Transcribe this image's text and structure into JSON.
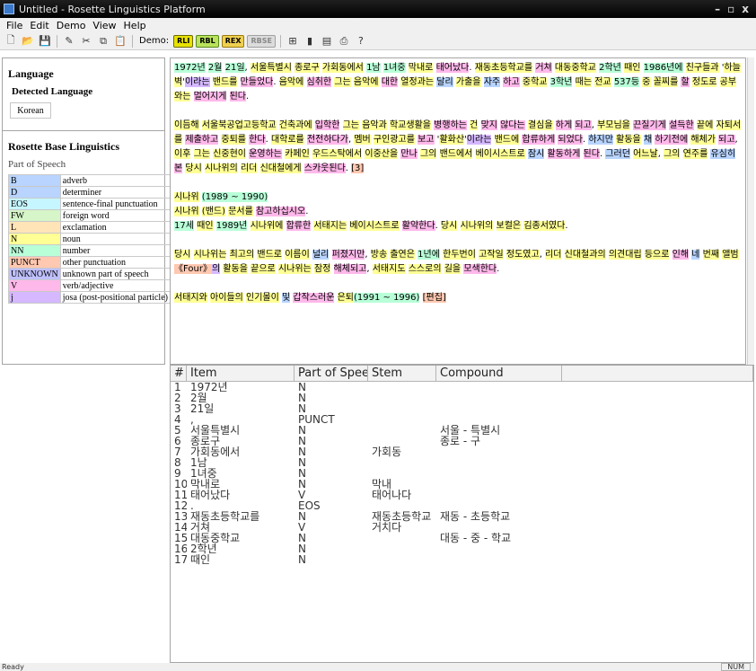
{
  "window": {
    "title": "Untitled - Rosette Linguistics Platform",
    "buttons": [
      "–",
      "▫",
      "x"
    ]
  },
  "menu": [
    "File",
    "Edit",
    "Demo",
    "View",
    "Help"
  ],
  "toolbar": {
    "demo_label": "Demo:",
    "demo_buttons": [
      "RLI",
      "RBL",
      "REX",
      "RBSE"
    ]
  },
  "language": {
    "title": "Language",
    "detected_label": "Detected Language",
    "value": "Korean"
  },
  "rbl": {
    "title": "Rosette Base Linguistics",
    "subtitle": "Part of Speech",
    "pos": [
      {
        "code": "B",
        "label": "adverb",
        "color": "#b8d4ff"
      },
      {
        "code": "D",
        "label": "determiner",
        "color": "#b8d4ff"
      },
      {
        "code": "EOS",
        "label": "sentence-final punctuation",
        "color": "#c6f6ff"
      },
      {
        "code": "FW",
        "label": "foreign word",
        "color": "#d6f5c8"
      },
      {
        "code": "L",
        "label": "exclamation",
        "color": "#ffe4b8"
      },
      {
        "code": "N",
        "label": "noun",
        "color": "#ffff96"
      },
      {
        "code": "NN",
        "label": "number",
        "color": "#b8ffd8"
      },
      {
        "code": "PUNCT",
        "label": "other punctuation",
        "color": "#ffc8b0"
      },
      {
        "code": "UNKNOWN",
        "label": "unknown part of speech",
        "color": "#c0c0ff"
      },
      {
        "code": "V",
        "label": "verb/adjective",
        "color": "#ffb8ea"
      },
      {
        "code": "j",
        "label": "josa (post-positional particle)",
        "color": "#d5b8ff"
      }
    ]
  },
  "text": {
    "paragraphs": [
      [
        [
          "1972년",
          "NN"
        ],
        " ",
        [
          "2월",
          "NN"
        ],
        " ",
        [
          "21일",
          "NN"
        ],
        ", ",
        [
          "서울특별시",
          "N"
        ],
        " ",
        [
          "종로구",
          "N"
        ],
        " ",
        [
          "가회동에서",
          "N"
        ],
        " ",
        [
          "1남",
          "NN"
        ],
        " ",
        [
          "1녀중",
          "NN"
        ],
        " ",
        [
          "막내로",
          "N"
        ],
        " ",
        [
          "태어났다",
          "V"
        ],
        ". ",
        [
          "재동초등학교를",
          "N"
        ],
        " ",
        [
          "거쳐",
          "V"
        ],
        " ",
        [
          "대동중학교",
          "N"
        ],
        " ",
        [
          "2학년",
          "NN"
        ],
        " ",
        [
          "때인",
          "N"
        ],
        " ",
        [
          "1986년에",
          "NN"
        ],
        " ",
        [
          "친구들과",
          "N"
        ],
        " '",
        [
          "하늘벽",
          "N"
        ],
        "'",
        [
          "이라는",
          "j"
        ],
        " ",
        [
          "밴드를",
          "N"
        ],
        " ",
        [
          "만들었다",
          "V"
        ],
        ". ",
        [
          "음악에",
          "N"
        ],
        " ",
        [
          "심취한",
          "V"
        ],
        " ",
        [
          "그는",
          "N"
        ],
        " ",
        [
          "음악에",
          "N"
        ],
        " ",
        [
          "대한",
          "V"
        ],
        " ",
        [
          "열정과는",
          "N"
        ],
        " ",
        [
          "달리",
          "B"
        ],
        " ",
        [
          "가출을",
          "N"
        ],
        " ",
        [
          "자주",
          "B"
        ],
        " ",
        [
          "하고",
          "V"
        ],
        " ",
        [
          "중학교",
          "N"
        ],
        " ",
        [
          "3학년",
          "NN"
        ],
        " ",
        [
          "때는",
          "N"
        ],
        " ",
        [
          "전교",
          "N"
        ],
        " ",
        [
          "537등",
          "NN"
        ],
        " ",
        [
          "중",
          "N"
        ],
        " ",
        [
          "꼴찌를",
          "N"
        ],
        " ",
        [
          "할",
          "V"
        ],
        " ",
        [
          "정도로",
          "N"
        ],
        " ",
        [
          "공부와는",
          "N"
        ],
        " ",
        [
          "멀어지게",
          "V"
        ],
        " ",
        [
          "된다",
          "V"
        ],
        "."
      ],
      [
        [
          "이듬해",
          "N"
        ],
        " ",
        [
          "서울북공업고등학교",
          "N"
        ],
        " ",
        [
          "건축과에",
          "N"
        ],
        " ",
        [
          "입학한",
          "V"
        ],
        " ",
        [
          "그는",
          "N"
        ],
        " ",
        [
          "음악과",
          "N"
        ],
        " ",
        [
          "학교생활을",
          "N"
        ],
        " ",
        [
          "병행하는",
          "V"
        ],
        " ",
        [
          "건",
          "N"
        ],
        " ",
        [
          "맞지",
          "V"
        ],
        " ",
        [
          "않다는",
          "V"
        ],
        " ",
        [
          "결심을",
          "N"
        ],
        " ",
        [
          "하게",
          "V"
        ],
        " ",
        [
          "되고",
          "V"
        ],
        ", ",
        [
          "부모님을",
          "N"
        ],
        " ",
        [
          "끈질기게",
          "V"
        ],
        " ",
        [
          "설득한",
          "V"
        ],
        " ",
        [
          "끝에",
          "N"
        ],
        " ",
        [
          "자퇴서를",
          "N"
        ],
        " ",
        [
          "제출하고",
          "V"
        ],
        " ",
        [
          "중퇴를",
          "N"
        ],
        " ",
        [
          "한다",
          "V"
        ],
        ". ",
        [
          "대학로를",
          "N"
        ],
        " ",
        [
          "전전하다가",
          "V"
        ],
        ", ",
        [
          "멤버",
          "N"
        ],
        " ",
        [
          "구인광고를",
          "N"
        ],
        " ",
        [
          "보고",
          "V"
        ],
        " '",
        [
          "활화산",
          "N"
        ],
        "'",
        [
          "이라는",
          "j"
        ],
        " ",
        [
          "밴드에",
          "N"
        ],
        " ",
        [
          "합류하게",
          "V"
        ],
        " ",
        [
          "되었다",
          "V"
        ],
        ". ",
        [
          "하지만",
          "B"
        ],
        " ",
        [
          "활동을",
          "N"
        ],
        " ",
        [
          "채",
          "B"
        ],
        " ",
        [
          "하기전에",
          "V"
        ],
        " ",
        [
          "해체가",
          "N"
        ],
        " ",
        [
          "되고",
          "V"
        ],
        ", ",
        [
          "이후",
          "N"
        ],
        " ",
        [
          "그는",
          "N"
        ],
        " ",
        [
          "신중현이",
          "N"
        ],
        " ",
        [
          "운영하는",
          "V"
        ],
        " ",
        [
          "카페인",
          "N"
        ],
        " ",
        [
          "우드스탁에서",
          "N"
        ],
        " ",
        [
          "이중산을",
          "N"
        ],
        " ",
        [
          "만나",
          "V"
        ],
        " ",
        [
          "그의",
          "N"
        ],
        " ",
        [
          "밴드에서",
          "N"
        ],
        " ",
        [
          "베이시스트로",
          "N"
        ],
        " ",
        [
          "잠시",
          "B"
        ],
        " ",
        [
          "활동하게",
          "V"
        ],
        " ",
        [
          "된다",
          "V"
        ],
        ". ",
        [
          "그러던",
          "B"
        ],
        " ",
        [
          "어느날",
          "N"
        ],
        ", ",
        [
          "그의",
          "N"
        ],
        " ",
        [
          "연주를",
          "N"
        ],
        " ",
        [
          "유심히",
          "B"
        ],
        " ",
        [
          "본",
          "V"
        ],
        " ",
        [
          "당시",
          "N"
        ],
        " ",
        [
          "시나위의",
          "N"
        ],
        " ",
        [
          "리더",
          "N"
        ],
        " ",
        [
          "신대철에게",
          "N"
        ],
        " ",
        [
          "스카웃된다",
          "V"
        ],
        ". ",
        [
          "[3]",
          "PUNCT"
        ]
      ],
      [
        " ",
        [
          "시나위",
          "N"
        ],
        " ",
        [
          "(1989 ~ 1990)",
          "NN"
        ],
        "<br>",
        [
          "시나위",
          "N"
        ],
        " ",
        [
          "(밴드)",
          "N"
        ],
        " ",
        [
          "문서를",
          "N"
        ],
        " ",
        [
          "참고하십시오",
          "V"
        ],
        ".<br>",
        [
          "17세",
          "NN"
        ],
        " ",
        [
          "때인",
          "N"
        ],
        " ",
        [
          "1989년",
          "NN"
        ],
        " ",
        [
          "시나위에",
          "N"
        ],
        " ",
        [
          "합류한",
          "V"
        ],
        " ",
        [
          "서태지는",
          "N"
        ],
        " ",
        [
          "베이시스트로",
          "N"
        ],
        " ",
        [
          "활약한다",
          "V"
        ],
        ". ",
        [
          "당시",
          "N"
        ],
        " ",
        [
          "시나위의",
          "N"
        ],
        " ",
        [
          "보컬은",
          "N"
        ],
        " ",
        [
          "김종서였다",
          "N"
        ],
        "."
      ],
      [
        [
          "당시",
          "N"
        ],
        " ",
        [
          "시나위는",
          "N"
        ],
        " ",
        [
          "최고의",
          "N"
        ],
        " ",
        [
          "밴드로",
          "N"
        ],
        " ",
        [
          "이름이",
          "N"
        ],
        " ",
        [
          "널리",
          "B"
        ],
        " ",
        [
          "퍼졌지만",
          "V"
        ],
        ", ",
        [
          "방송",
          "N"
        ],
        " ",
        [
          "출연은",
          "N"
        ],
        " ",
        [
          "1년에",
          "NN"
        ],
        " ",
        [
          "한두번이",
          "N"
        ],
        " ",
        [
          "고작일",
          "N"
        ],
        " ",
        [
          "정도였고",
          "N"
        ],
        ", ",
        [
          "리더",
          "N"
        ],
        " ",
        [
          "신대철과의",
          "N"
        ],
        " ",
        [
          "의견대립",
          "N"
        ],
        " ",
        [
          "등으로",
          "N"
        ],
        " ",
        [
          "인해",
          "V"
        ],
        " ",
        [
          "네",
          "D"
        ],
        " ",
        [
          "번째",
          "N"
        ],
        " ",
        [
          "앨범",
          "N"
        ],
        " ",
        [
          "《Four》",
          "PUNCT"
        ],
        "",
        [
          "의",
          "j"
        ],
        " ",
        [
          "활동을",
          "N"
        ],
        " ",
        [
          "끝으로",
          "N"
        ],
        " ",
        [
          "시나위는",
          "N"
        ],
        " ",
        [
          "잠정",
          "N"
        ],
        " ",
        [
          "해체되고",
          "V"
        ],
        ", ",
        [
          "서태지도",
          "N"
        ],
        " ",
        [
          "스스로의",
          "N"
        ],
        " ",
        [
          "길을",
          "N"
        ],
        " ",
        [
          "모색한다",
          "V"
        ],
        "."
      ],
      [
        " ",
        [
          "서태지와",
          "N"
        ],
        " ",
        [
          "아이들의",
          "N"
        ],
        " ",
        [
          "인기몰이",
          "N"
        ],
        " ",
        [
          "및",
          "B"
        ],
        " ",
        [
          "갑작스러운",
          "V"
        ],
        " ",
        [
          "은퇴",
          "N"
        ],
        [
          "(1991 ~ 1996)",
          "NN"
        ],
        " ",
        [
          "[편집]",
          "PUNCT"
        ]
      ]
    ]
  },
  "grid": {
    "columns": [
      "#",
      "Item",
      "Part of Speech",
      "Stem",
      "Compound",
      ""
    ],
    "rows": [
      [
        "1",
        "1972년",
        "N",
        "",
        ""
      ],
      [
        "2",
        "2월",
        "N",
        "",
        ""
      ],
      [
        "3",
        "21일",
        "N",
        "",
        ""
      ],
      [
        "4",
        ",",
        "PUNCT",
        "",
        ""
      ],
      [
        "5",
        "서울특별시",
        "N",
        "",
        "서울 - 특별시"
      ],
      [
        "6",
        "종로구",
        "N",
        "",
        "종로 - 구"
      ],
      [
        "7",
        "가회동에서",
        "N",
        "가회동",
        ""
      ],
      [
        "8",
        "1남",
        "N",
        "",
        ""
      ],
      [
        "9",
        "1녀중",
        "N",
        "",
        ""
      ],
      [
        "10",
        "막내로",
        "N",
        "막내",
        ""
      ],
      [
        "11",
        "태어났다",
        "V",
        "태어나다",
        ""
      ],
      [
        "12",
        ".",
        "EOS",
        "",
        ""
      ],
      [
        "13",
        "재동초등학교를",
        "N",
        "재동초등학교",
        "재동 - 초등학교"
      ],
      [
        "14",
        "거쳐",
        "V",
        "거치다",
        ""
      ],
      [
        "15",
        "대동중학교",
        "N",
        "",
        "대동 - 중 - 학교"
      ],
      [
        "16",
        "2학년",
        "N",
        "",
        ""
      ],
      [
        "17",
        "때인",
        "N",
        "",
        ""
      ]
    ]
  },
  "status": {
    "left": "Ready",
    "right": "NUM"
  }
}
